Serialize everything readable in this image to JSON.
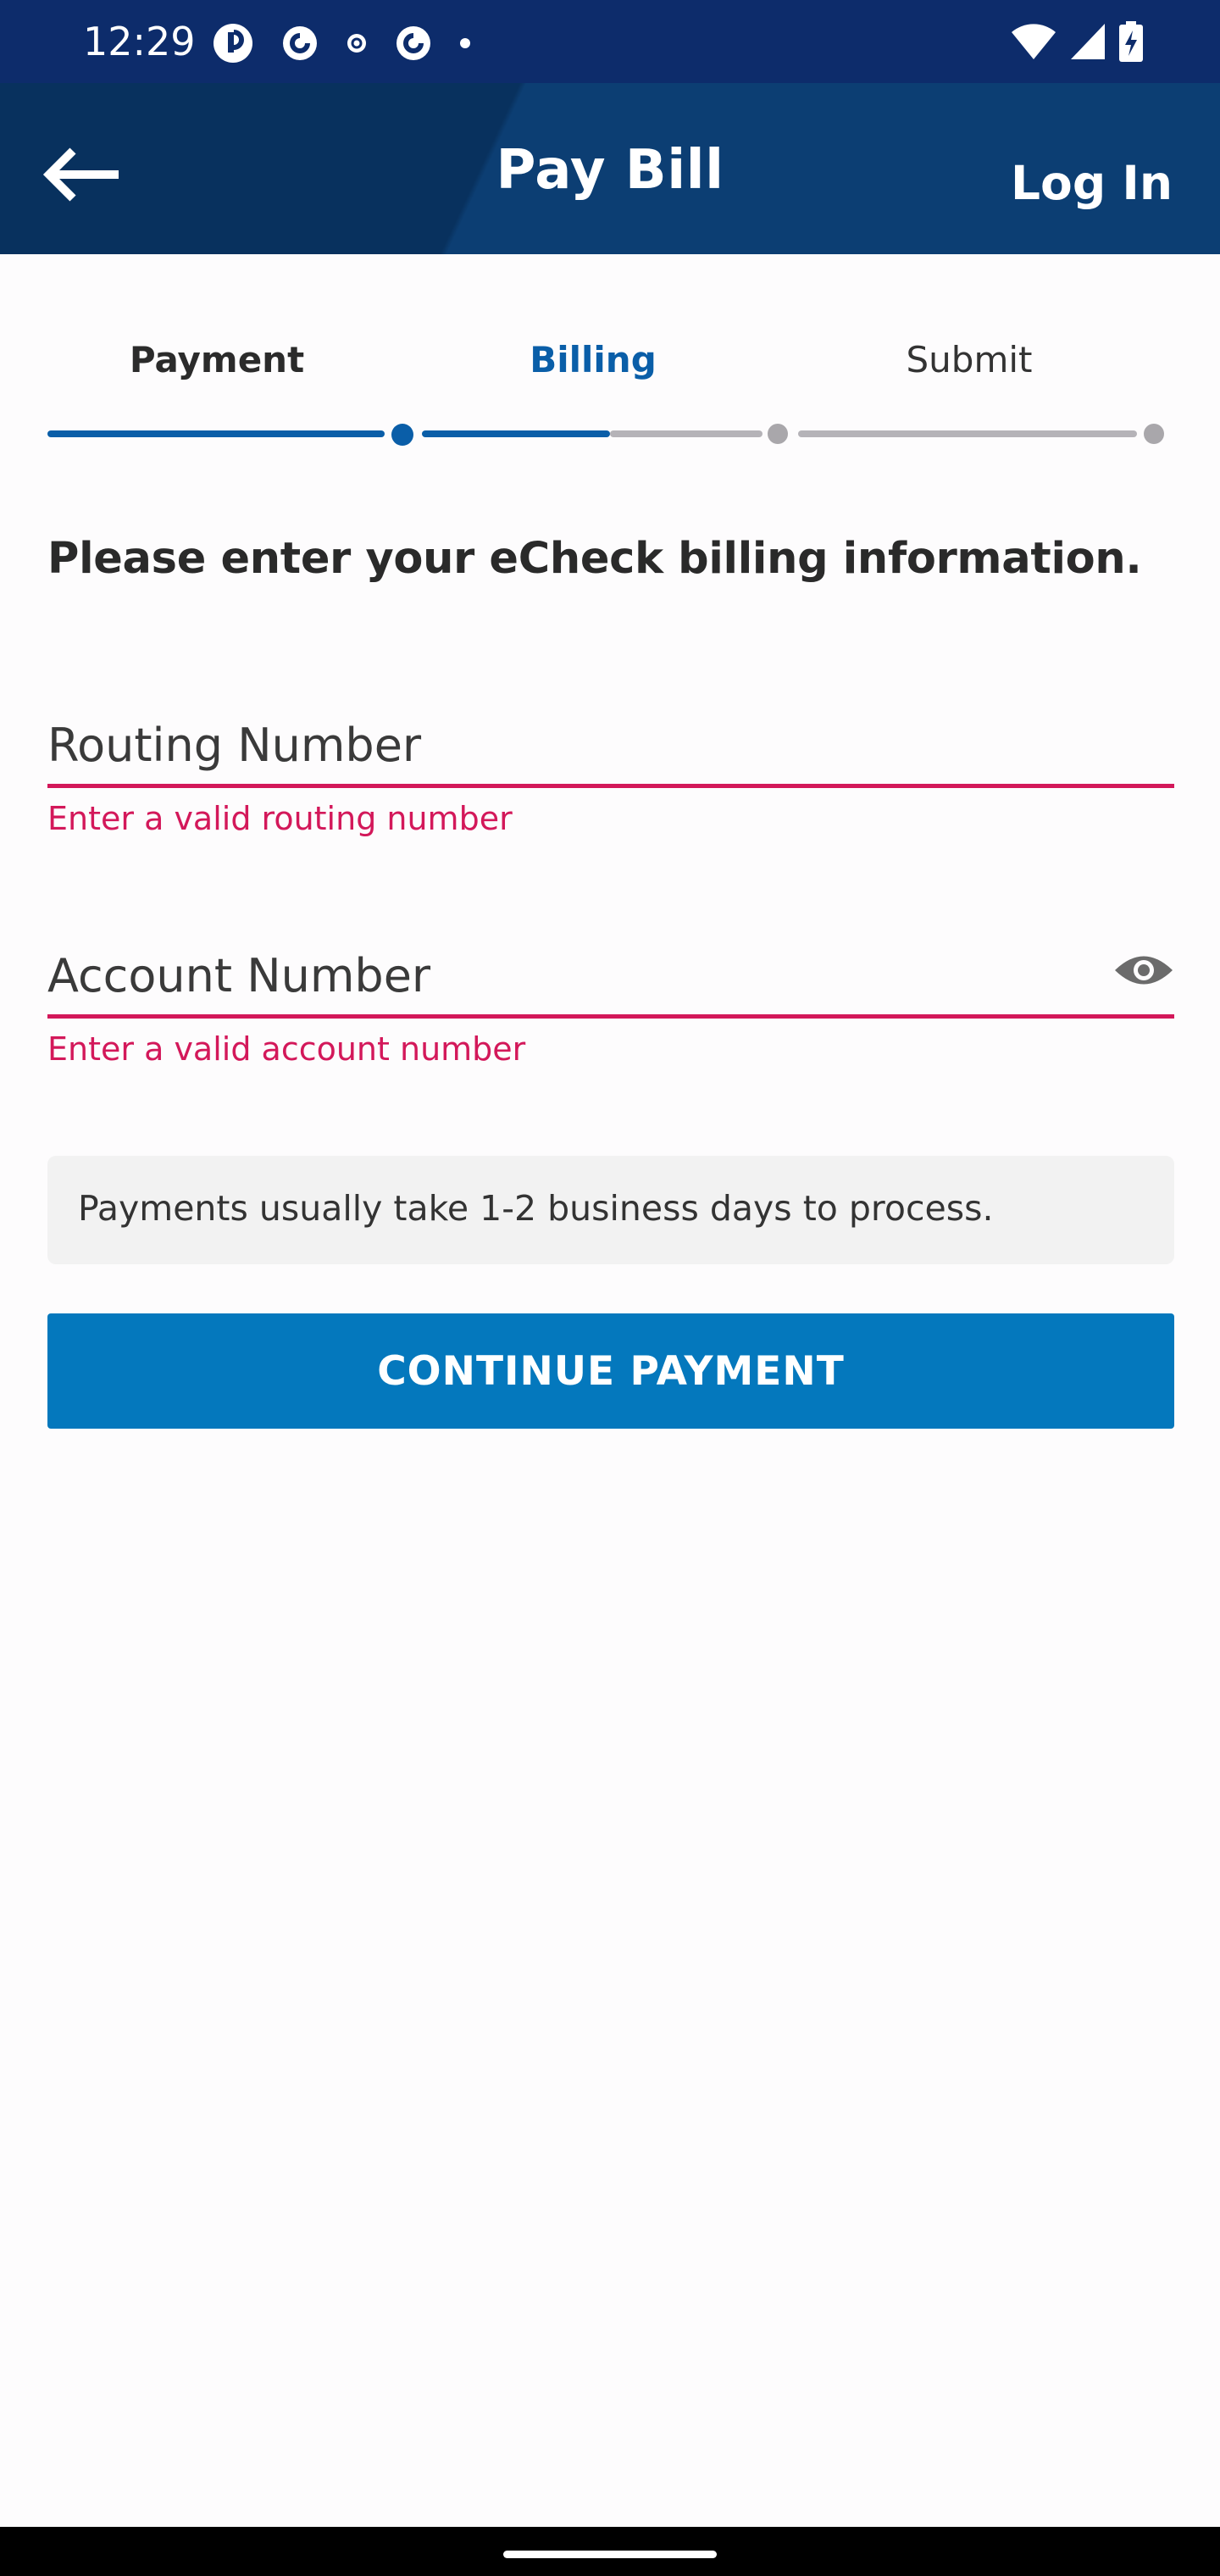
{
  "status_bar": {
    "time": "12:29",
    "left_icons": [
      "app-notification-icon",
      "pocket-casts-icon",
      "small-notification-icon",
      "pocket-casts-icon",
      "dot-icon"
    ],
    "right_icons": [
      "wifi-icon",
      "signal-icon",
      "battery-charging-icon"
    ]
  },
  "header": {
    "title": "Pay Bill",
    "login_label": "Log In",
    "background": "#08315e"
  },
  "stepper": {
    "steps": [
      {
        "label": "Payment",
        "state": "complete"
      },
      {
        "label": "Billing",
        "state": "active"
      },
      {
        "label": "Submit",
        "state": "pending"
      }
    ],
    "active_color": "#0a5ea8",
    "inactive_color": "#b5b3b8"
  },
  "form": {
    "heading": "Please enter your eCheck billing information.",
    "routing": {
      "placeholder": "Routing Number",
      "value": "",
      "error": "Enter a valid routing number"
    },
    "account": {
      "placeholder": "Account Number",
      "value": "",
      "error": "Enter a valid account number",
      "toggle_icon": "eye-icon"
    },
    "error_color": "#d3185a"
  },
  "info": {
    "text": "Payments usually take 1-2 business days to process."
  },
  "actions": {
    "continue_label": "CONTINUE PAYMENT",
    "continue_color": "#0478bd"
  }
}
